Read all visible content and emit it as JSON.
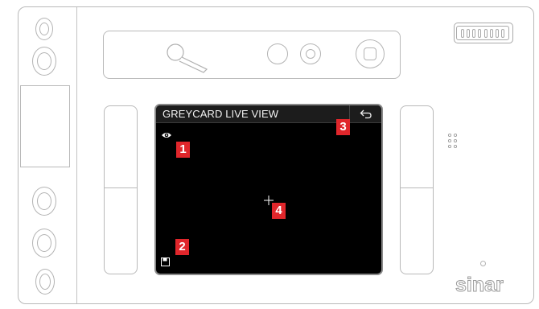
{
  "screen": {
    "title": "GREYCARD LIVE VIEW",
    "icons": {
      "view_mode": "eye-icon",
      "save": "save-icon",
      "back": "back-arrow-icon",
      "center": "crosshair-icon"
    }
  },
  "markers": [
    "1",
    "2",
    "3",
    "4"
  ],
  "brand": "sinar",
  "colors": {
    "marker": "#e0262b",
    "screen_background": "#000000",
    "outline": "#b9b9b9"
  }
}
